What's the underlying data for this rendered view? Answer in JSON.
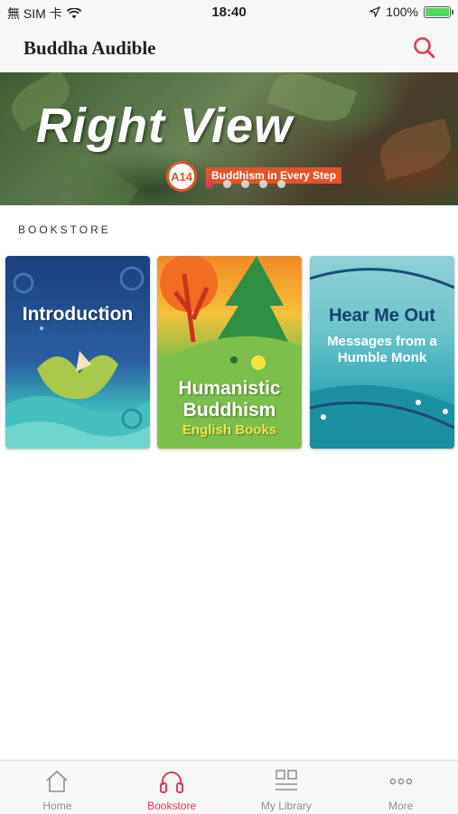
{
  "status_bar": {
    "carrier": "無 SIM 卡",
    "time": "18:40",
    "battery_percent": "100%",
    "battery_level": 1.0
  },
  "header": {
    "title": "Buddha Audible",
    "search_icon": "search-icon"
  },
  "banner": {
    "title": "Right View",
    "badge": "A14",
    "subtitle": "Buddhism in Every Step",
    "slide_count": 5,
    "active_slide": 0
  },
  "section": {
    "title": "BOOKSTORE"
  },
  "books": [
    {
      "title": "Introduction",
      "subtitle": ""
    },
    {
      "title": "Humanistic Buddhism",
      "subtitle": "English Books"
    },
    {
      "title": "Hear Me Out",
      "subtitle": "Messages from a Humble Monk"
    }
  ],
  "tabs": [
    {
      "label": "Home",
      "icon": "home-icon",
      "active": false
    },
    {
      "label": "Bookstore",
      "icon": "headphones-icon",
      "active": true
    },
    {
      "label": "My Library",
      "icon": "library-icon",
      "active": false
    },
    {
      "label": "More",
      "icon": "more-icon",
      "active": false
    }
  ],
  "colors": {
    "accent": "#e8365b",
    "badge": "#e2552c",
    "battery": "#4cd964"
  }
}
